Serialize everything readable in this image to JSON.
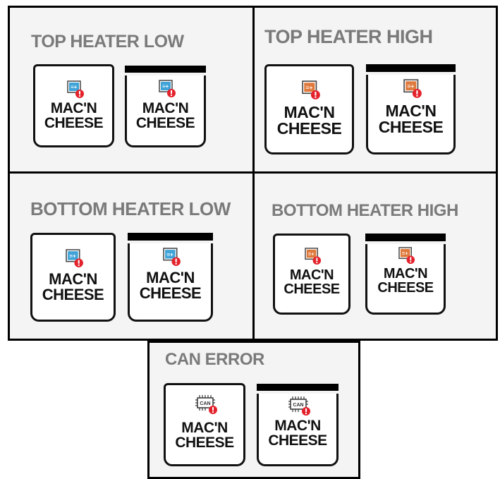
{
  "panels": [
    {
      "title": "TOP HEATER LOW",
      "icon": "heater-warning-icon",
      "icon_color": "#3fa3d8"
    },
    {
      "title": "TOP HEATER HIGH",
      "icon": "heater-warning-icon",
      "icon_color": "#e07a3c"
    },
    {
      "title": "BOTTOM HEATER LOW",
      "icon": "heater-warning-icon",
      "icon_color": "#3fa3d8"
    },
    {
      "title": "BOTTOM HEATER HIGH",
      "icon": "heater-warning-icon",
      "icon_color": "#e07a3c"
    },
    {
      "title": "CAN ERROR",
      "icon": "can-chip-warning-icon",
      "icon_color": "#333333"
    }
  ],
  "well_label_line1": "MAC'N",
  "well_label_line2": "CHEESE",
  "can_chip_text": "CAN",
  "warning_color": "#e4222b"
}
